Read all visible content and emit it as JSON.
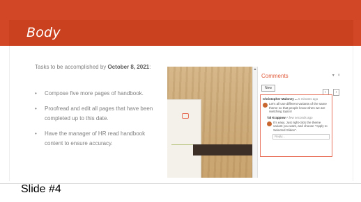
{
  "slide": {
    "title": "Body",
    "intro_prefix": "Tasks to be accomplished by ",
    "intro_date": "October 8, 2021",
    "intro_suffix": ":",
    "bullets": [
      "Compose five more pages of handbook.",
      "Proofread and edit all pages that have been completed up to this date.",
      "Have the manager of HR read handbook content to ensure accuracy."
    ],
    "bullet_glyph": "•"
  },
  "screenshot": {
    "comments_pane": {
      "title": "Comments",
      "menu_icon": "▾",
      "close_icon": "×",
      "new_button": "New",
      "prev_icon": "‹",
      "next_icon": "›",
      "comment": {
        "author": "Christopher Maloney ...",
        "time": "5 minutes ago",
        "body": "Let's all use different variants of the same theme so that people know when we are switching topics!"
      },
      "reply": {
        "author": "Tal Krappow",
        "time": "A few seconds ago",
        "body": "It's easy. Just right-click the theme variant you want, and choose \"Apply to Selected Slides\"."
      },
      "reply_placeholder": "Reply..."
    },
    "scroll_up_icon": "▲"
  },
  "caption": "Slide #4",
  "colors": {
    "header": "#d24726",
    "accent": "#e05a3a",
    "body_text": "#7f7f7f"
  }
}
